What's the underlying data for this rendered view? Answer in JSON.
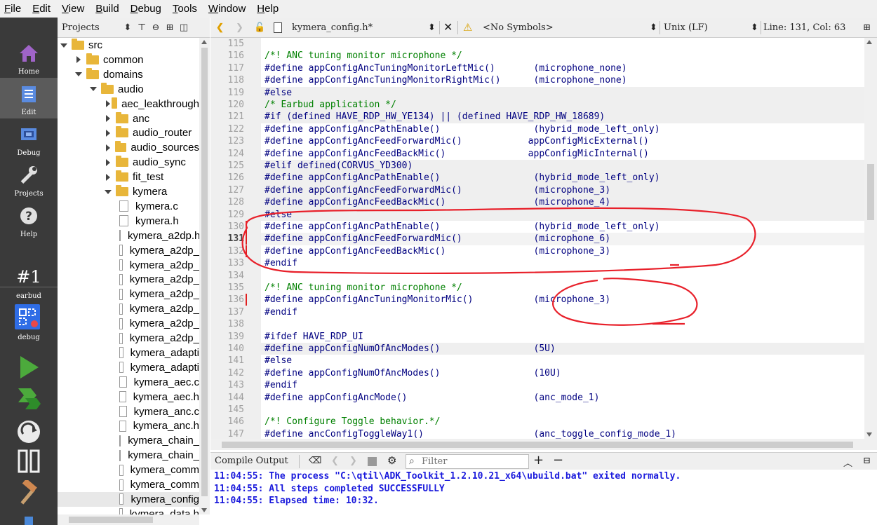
{
  "menu": [
    "File",
    "Edit",
    "View",
    "Build",
    "Debug",
    "Tools",
    "Window",
    "Help"
  ],
  "modes": [
    {
      "label": "Home",
      "icon": "home-icon"
    },
    {
      "label": "Edit",
      "icon": "edit-icon"
    },
    {
      "label": "Debug",
      "icon": "debug-icon"
    },
    {
      "label": "Projects",
      "icon": "wrench-icon"
    },
    {
      "label": "Help",
      "icon": "help-icon"
    }
  ],
  "kit": {
    "number": "#1",
    "project": "earbud",
    "config": "debug"
  },
  "projects_pane": {
    "title": "Projects"
  },
  "tree": [
    {
      "label": "src",
      "type": "folder",
      "depth": 0,
      "expanded": true
    },
    {
      "label": "common",
      "type": "folder",
      "depth": 1,
      "expanded": false
    },
    {
      "label": "domains",
      "type": "folder",
      "depth": 1,
      "expanded": true
    },
    {
      "label": "audio",
      "type": "folder",
      "depth": 2,
      "expanded": true
    },
    {
      "label": "aec_leakthrough",
      "type": "folder",
      "depth": 3,
      "expanded": false
    },
    {
      "label": "anc",
      "type": "folder",
      "depth": 3,
      "expanded": false
    },
    {
      "label": "audio_router",
      "type": "folder",
      "depth": 3,
      "expanded": false
    },
    {
      "label": "audio_sources",
      "type": "folder",
      "depth": 3,
      "expanded": false
    },
    {
      "label": "audio_sync",
      "type": "folder",
      "depth": 3,
      "expanded": false
    },
    {
      "label": "fit_test",
      "type": "folder",
      "depth": 3,
      "expanded": false
    },
    {
      "label": "kymera",
      "type": "folder",
      "depth": 3,
      "expanded": true
    },
    {
      "label": "kymera.c",
      "type": "file",
      "depth": 4
    },
    {
      "label": "kymera.h",
      "type": "file",
      "depth": 4
    },
    {
      "label": "kymera_a2dp.h",
      "type": "file",
      "depth": 4
    },
    {
      "label": "kymera_a2dp_",
      "type": "file",
      "depth": 4
    },
    {
      "label": "kymera_a2dp_",
      "type": "file",
      "depth": 4
    },
    {
      "label": "kymera_a2dp_",
      "type": "file",
      "depth": 4
    },
    {
      "label": "kymera_a2dp_",
      "type": "file",
      "depth": 4
    },
    {
      "label": "kymera_a2dp_",
      "type": "file",
      "depth": 4
    },
    {
      "label": "kymera_a2dp_",
      "type": "file",
      "depth": 4
    },
    {
      "label": "kymera_a2dp_",
      "type": "file",
      "depth": 4
    },
    {
      "label": "kymera_adapti",
      "type": "file",
      "depth": 4
    },
    {
      "label": "kymera_adapti",
      "type": "file",
      "depth": 4
    },
    {
      "label": "kymera_aec.c",
      "type": "file",
      "depth": 4
    },
    {
      "label": "kymera_aec.h",
      "type": "file",
      "depth": 4
    },
    {
      "label": "kymera_anc.c",
      "type": "file",
      "depth": 4
    },
    {
      "label": "kymera_anc.h",
      "type": "file",
      "depth": 4
    },
    {
      "label": "kymera_chain_",
      "type": "file",
      "depth": 4
    },
    {
      "label": "kymera_chain_",
      "type": "file",
      "depth": 4
    },
    {
      "label": "kymera_comm",
      "type": "file",
      "depth": 4
    },
    {
      "label": "kymera_comm",
      "type": "file",
      "depth": 4
    },
    {
      "label": "kymera_config",
      "type": "file",
      "depth": 4,
      "selected": true
    },
    {
      "label": "kymera_data.h",
      "type": "file",
      "depth": 4
    }
  ],
  "editor_toolbar": {
    "file_name": "kymera_config.h*",
    "symbols": "<No Symbols>",
    "line_ending": "Unix (LF)",
    "position": "Line: 131, Col: 63"
  },
  "code": [
    {
      "n": "115",
      "text": "",
      "kind": "tx"
    },
    {
      "n": "116",
      "text": "/*! ANC tuning monitor microphone */",
      "kind": "cm"
    },
    {
      "n": "117",
      "text": "#define appConfigAncTuningMonitorLeftMic()       (microphone_none)",
      "kind": "pp"
    },
    {
      "n": "118",
      "text": "#define appConfigAncTuningMonitorRightMic()      (microphone_none)",
      "kind": "pp"
    },
    {
      "n": "119",
      "text": "#else",
      "kind": "pp",
      "bg": "gray"
    },
    {
      "n": "120",
      "text": "/* Earbud application */",
      "kind": "cm",
      "bg": "gray"
    },
    {
      "n": "121",
      "text": "#if (defined HAVE_RDP_HW_YE134) || (defined HAVE_RDP_HW_18689)",
      "kind": "pp",
      "bg": "gray"
    },
    {
      "n": "122",
      "text": "#define appConfigAncPathEnable()                 (hybrid_mode_left_only)",
      "kind": "pp"
    },
    {
      "n": "123",
      "text": "#define appConfigAncFeedForwardMic()            appConfigMicExternal()",
      "kind": "pp"
    },
    {
      "n": "124",
      "text": "#define appConfigAncFeedBackMic()               appConfigMicInternal()",
      "kind": "pp"
    },
    {
      "n": "125",
      "text": "#elif defined(CORVUS_YD300)",
      "kind": "pp",
      "bg": "gray"
    },
    {
      "n": "126",
      "text": "#define appConfigAncPathEnable()                 (hybrid_mode_left_only)",
      "kind": "pp",
      "bg": "gray"
    },
    {
      "n": "127",
      "text": "#define appConfigAncFeedForwardMic()             (microphone_3)",
      "kind": "pp",
      "bg": "gray"
    },
    {
      "n": "128",
      "text": "#define appConfigAncFeedBackMic()                (microphone_4)",
      "kind": "pp",
      "bg": "gray"
    },
    {
      "n": "129",
      "text": "#else",
      "kind": "pp",
      "bg": "gray"
    },
    {
      "n": "130",
      "text": "#define appConfigAncPathEnable()                 (hybrid_mode_left_only)",
      "kind": "pp",
      "mark": true
    },
    {
      "n": "131",
      "text": "#define appConfigAncFeedForwardMic()             (microphone_6)",
      "kind": "pp",
      "mark": true,
      "current": true
    },
    {
      "n": "132",
      "text": "#define appConfigAncFeedBackMic()                (microphone_3)",
      "kind": "pp",
      "mark": true
    },
    {
      "n": "133",
      "text": "#endif",
      "kind": "pp"
    },
    {
      "n": "134",
      "text": "",
      "kind": "tx"
    },
    {
      "n": "135",
      "text": "/*! ANC tuning monitor microphone */",
      "kind": "cm"
    },
    {
      "n": "136",
      "text": "#define appConfigAncTuningMonitorMic()           (microphone_3)",
      "kind": "pp",
      "mark": true
    },
    {
      "n": "137",
      "text": "#endif",
      "kind": "pp"
    },
    {
      "n": "138",
      "text": "",
      "kind": "tx"
    },
    {
      "n": "139",
      "text": "#ifdef HAVE_RDP_UI",
      "kind": "pp"
    },
    {
      "n": "140",
      "text": "#define appConfigNumOfAncModes()                 (5U)",
      "kind": "pp",
      "bg": "gray"
    },
    {
      "n": "141",
      "text": "#else",
      "kind": "pp"
    },
    {
      "n": "142",
      "text": "#define appConfigNumOfAncModes()                 (10U)",
      "kind": "pp"
    },
    {
      "n": "143",
      "text": "#endif",
      "kind": "pp"
    },
    {
      "n": "144",
      "text": "#define appConfigAncMode()                       (anc_mode_1)",
      "kind": "pp"
    },
    {
      "n": "145",
      "text": "",
      "kind": "tx"
    },
    {
      "n": "146",
      "text": "/*! Configure Toggle behavior.*/",
      "kind": "cm"
    },
    {
      "n": "147",
      "text": "#define ancConfigToggleWay1()                    (anc_toggle_config_mode_1)",
      "kind": "pp"
    }
  ],
  "output_pane": {
    "title": "Compile Output",
    "filter_placeholder": "Filter",
    "lines": [
      "11:04:55: The process \"C:\\qtil\\ADK_Toolkit_1.2.10.21_x64\\ubuild.bat\" exited normally.",
      "11:04:55: All steps completed SUCCESSFULLY",
      "11:04:55: Elapsed time: 10:32."
    ]
  },
  "colors": {
    "annotation": "#e8202a",
    "preprocessor": "#000080",
    "comment": "#008000",
    "output_text": "#1a1adc"
  }
}
